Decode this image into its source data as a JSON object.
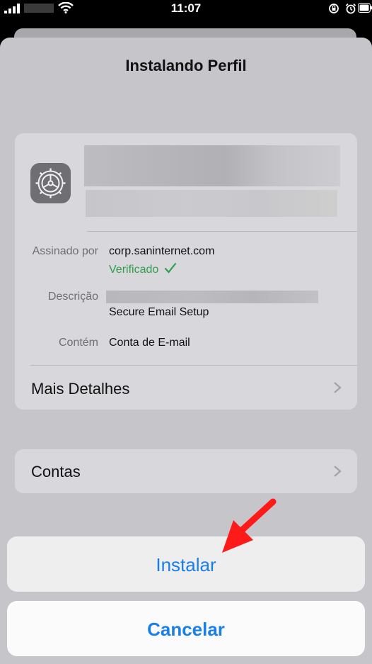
{
  "status_bar": {
    "time": "11:07"
  },
  "sheet": {
    "title": "Instalando Perfil"
  },
  "profile": {
    "signed_by_label": "Assinado por",
    "signed_by_value": "corp.saninternet.com",
    "verified_text": "Verificado",
    "description_label": "Descrição",
    "description_value": "Secure Email Setup",
    "contains_label": "Contém",
    "contains_value": "Conta de E-mail",
    "more_details": "Mais Detalhes"
  },
  "accounts_row": "Contas",
  "action_sheet": {
    "install": "Instalar",
    "cancel": "Cancelar"
  },
  "colors": {
    "accent": "#1a7fe6",
    "verified": "#2e9e4a",
    "annotation_arrow": "#ff1a1a"
  },
  "icons": [
    "signal-icon",
    "wifi-icon",
    "rotation-lock-icon",
    "alarm-icon",
    "battery-icon",
    "settings-gear-icon",
    "checkmark-icon",
    "chevron-right-icon",
    "red-arrow-annotation"
  ]
}
